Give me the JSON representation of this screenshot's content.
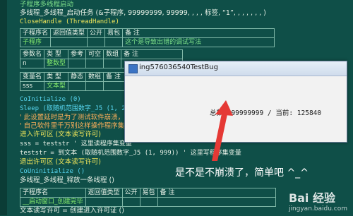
{
  "code": {
    "line1": "子程序多线程启动",
    "line2_call": "多线程_多线程_启动任务 (&子程序, 99999999, 99999, , , , 标签, “1”, , , , , , , )",
    "line3": "CloseHandle (ThreadHandle)",
    "table1": {
      "headers": [
        "子程序名",
        "返回值类型",
        "公开",
        "易包",
        "备 注"
      ],
      "name": "子程序",
      "comment": "这个是导致出错的调试写法"
    },
    "table2": {
      "headers": [
        "参数名",
        "类 型",
        "参考",
        "可空",
        "数组",
        "备 注"
      ],
      "param_name": "n",
      "param_type": "整数型"
    },
    "table3": {
      "headers": [
        "变量名",
        "类 型",
        "静态",
        "数组",
        "备 注"
      ],
      "var_name": "sss",
      "var_type": "文本型"
    },
    "lines": [
      "CoInitialize (0)",
      "Sleep (取随机范围数字_J5 (1, 2))",
      "' 此设置延时是为了测试软件崩溃，是",
      "' 自己软件里千万别这样操作程序集变量",
      "进入许可区 (文本读写许可)",
      "sss = teststr      ' 这里读程序集变量",
      "teststr = 到文本 (取随机范围数字_J5 (1, 999))      ' 这里写程序集变量",
      "退出许可区 (文本读写许可)",
      "CoUninitialize ()",
      "多线程_多线程_释放一条线程 ()"
    ],
    "table4": {
      "headers": [
        "子程序名",
        "返回值类型",
        "公开",
        "易包",
        "备 注"
      ],
      "name": "__启动窗口_创建完毕"
    },
    "last_line": "文本读写许可 = 创建进入许可证 ()"
  },
  "dialog": {
    "title": "ing576036540TestBug",
    "status": "总数: 99999999 / 当前: 125840"
  },
  "caption": "是不是不崩溃了，简单吧 ^_^",
  "watermark": {
    "brand": "Bai 经验",
    "url": "jingyan.baidu.com"
  },
  "colors": {
    "background": "#0f4f48",
    "arrow": "#e53935"
  }
}
